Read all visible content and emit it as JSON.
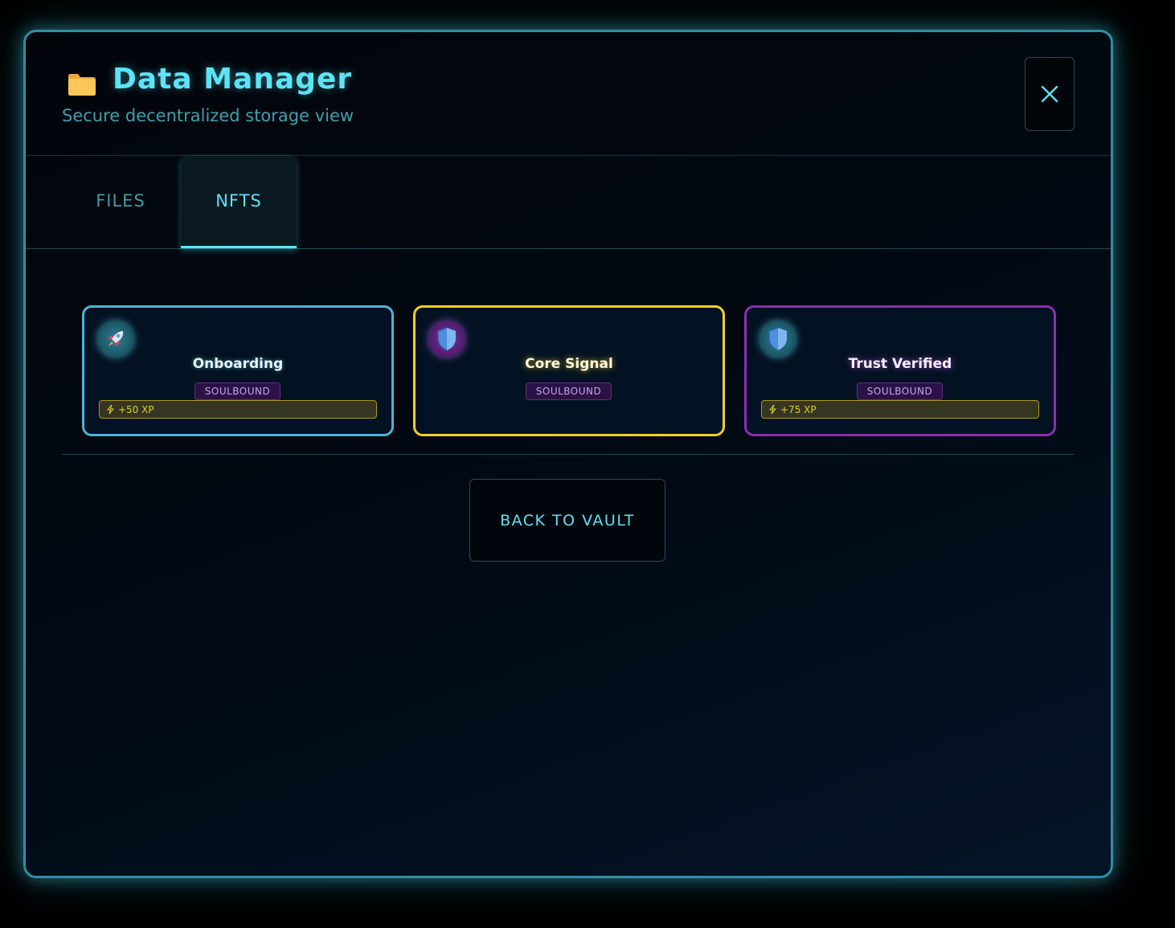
{
  "header": {
    "folder_icon": "folder-icon",
    "title": "Data Manager",
    "subtitle": "Secure decentralized storage view",
    "close_icon": "close-icon"
  },
  "tabs": [
    {
      "label": "FILES",
      "active": false
    },
    {
      "label": "NFTS",
      "active": true
    }
  ],
  "nfts": [
    {
      "name": "Onboarding",
      "badge": "SOULBOUND",
      "xp": "+50 XP",
      "icon": "rocket-icon",
      "border_color": "#4fb3d3"
    },
    {
      "name": "Core Signal",
      "badge": "SOULBOUND",
      "icon": "shield-icon",
      "border_color": "#f2d025"
    },
    {
      "name": "Trust Verified",
      "badge": "SOULBOUND",
      "xp": "+75 XP",
      "icon": "shield-icon",
      "border_color": "#8a2fb0"
    }
  ],
  "footer": {
    "back_label": "BACK TO VAULT"
  },
  "colors": {
    "accent": "#5ce3f5",
    "frame": "#2f8ea3",
    "badge_bg": "#2a1146",
    "xp_text": "#e4cf2a"
  }
}
